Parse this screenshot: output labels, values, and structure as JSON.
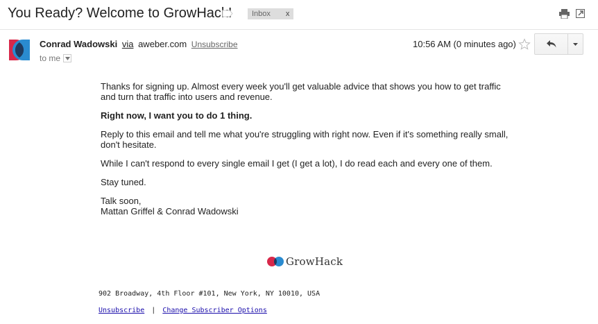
{
  "email": {
    "subject": "You Ready? Welcome to GrowHack!",
    "label_chip": {
      "text": "Inbox",
      "remove": "x"
    },
    "sender": {
      "name": "Conrad Wadowski",
      "via": "via",
      "domain": "aweber.com",
      "unsubscribe": "Unsubscribe"
    },
    "recipient": "to me",
    "timestamp": "10:56 AM (0 minutes ago)",
    "body": {
      "p1": "Thanks for signing up. Almost every week you'll get valuable advice that shows you how to get traffic and turn that traffic into users and revenue.",
      "p2": "Right now, I want you to do 1 thing.",
      "p3": "Reply to this email and tell me what you're struggling with right now. Even if it's something really small, don't hesitate.",
      "p4": "While I can't respond to every single email I get (I get a lot), I do read each and every one of them.",
      "p5": "Stay tuned.",
      "signoff_line1": "Talk soon,",
      "signoff_line2": "Mattan Griffel & Conrad Wadowski"
    },
    "footer": {
      "logo_text": "GrowHack",
      "address": "902 Broadway, 4th Floor #101, New York, NY 10010, USA",
      "unsubscribe_link": "Unsubscribe",
      "separator": "|",
      "change_options_link": "Change Subscriber Options"
    }
  },
  "colors": {
    "brand_red": "#d8284a",
    "brand_blue": "#2a8bd0",
    "avatar_dark": "#1e3a5f",
    "link_blue": "#1a0dab"
  },
  "icons": [
    "label-icon",
    "print-icon",
    "new-window-icon",
    "star-icon",
    "reply-icon",
    "dropdown-arrow-icon",
    "caret-down-icon"
  ]
}
